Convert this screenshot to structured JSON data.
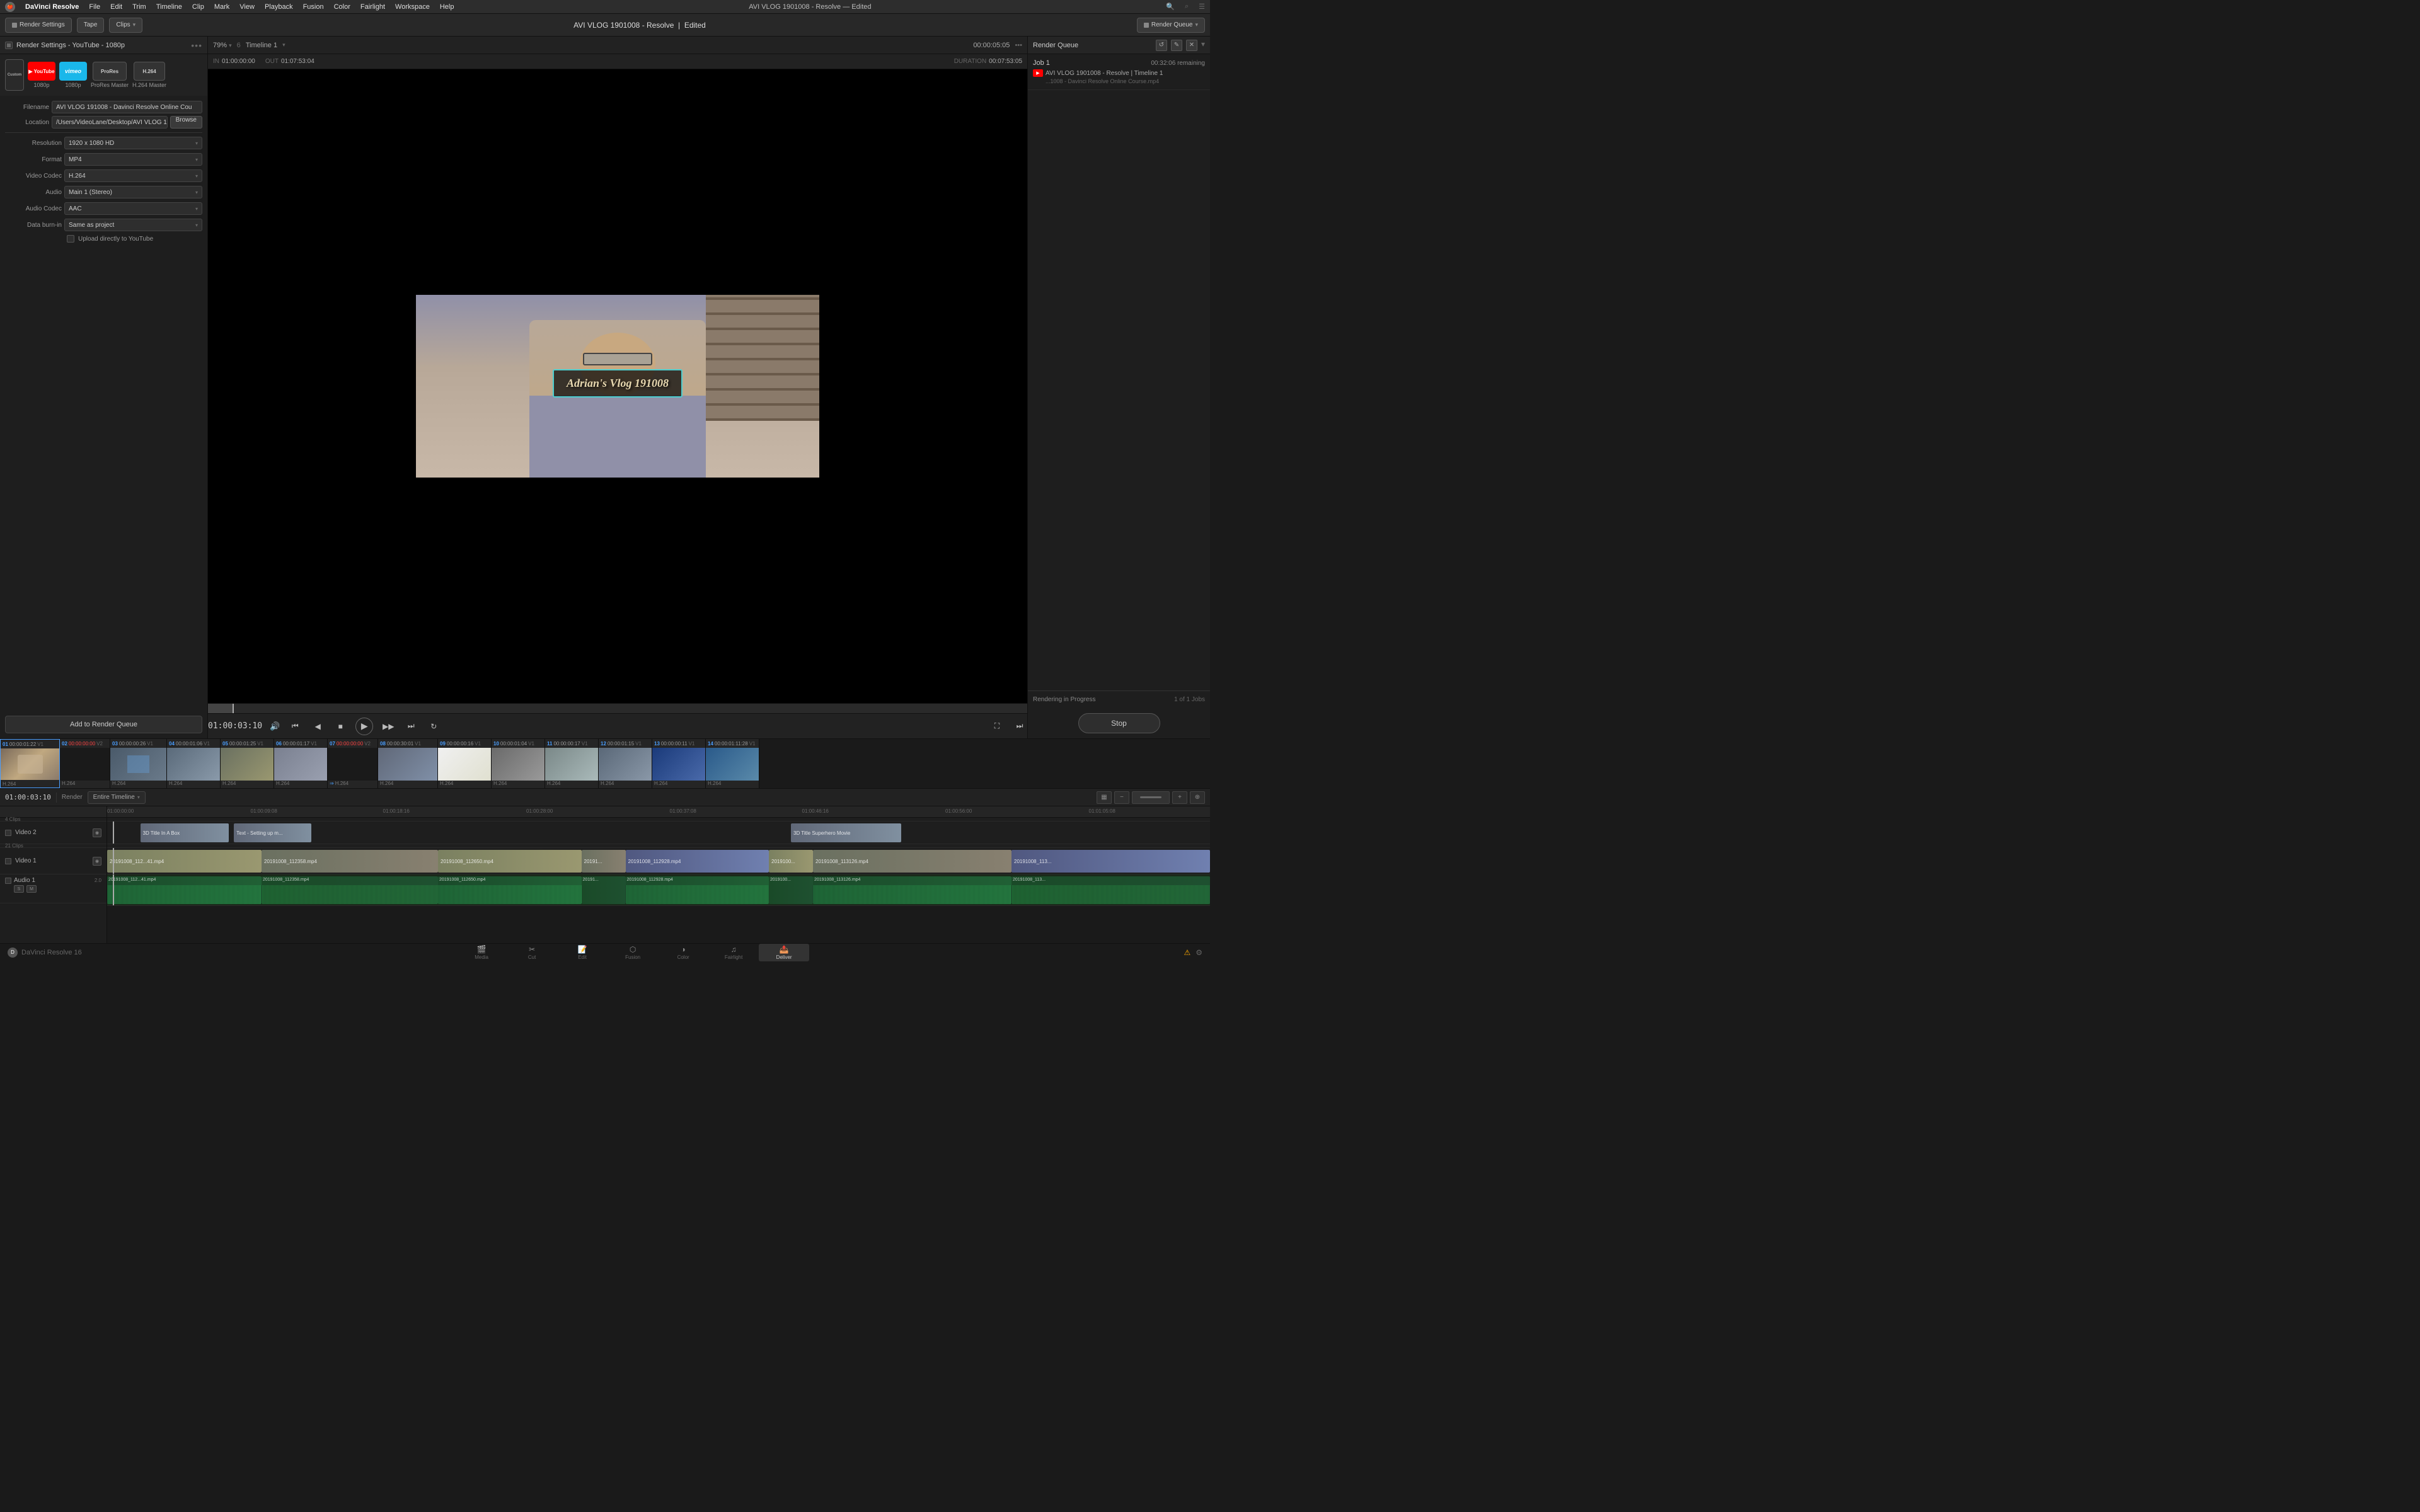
{
  "app": {
    "name": "DaVinci Resolve",
    "version": "DaVinci Resolve 16",
    "window_title": "AVI VLOG 1901008 - Resolve",
    "window_subtitle": "Edited"
  },
  "menu": {
    "apple": "🍎",
    "app_name": "DaVinci Resolve",
    "items": [
      "File",
      "Edit",
      "Trim",
      "Timeline",
      "Clip",
      "Mark",
      "View",
      "Playback",
      "Fusion",
      "Color",
      "Fairlight",
      "Workspace",
      "Help"
    ]
  },
  "toolbar": {
    "render_settings_label": "Render Settings",
    "tape_label": "Tape",
    "clips_label": "Clips",
    "title": "AVI VLOG 1901008 - Resolve",
    "subtitle": "Edited",
    "render_queue_label": "Render Queue"
  },
  "render_settings": {
    "panel_title": "Render Settings - YouTube - 1080p",
    "presets": [
      {
        "id": "custom",
        "label": "Custom"
      },
      {
        "id": "youtube",
        "label": "1080p",
        "brand": "YouTube"
      },
      {
        "id": "vimeo",
        "label": "1080p",
        "brand": "vimeo"
      },
      {
        "id": "prores",
        "label": "ProRes Master",
        "brand": "ProRes"
      },
      {
        "id": "h264",
        "label": "H.264 Master",
        "brand": "H.264"
      }
    ],
    "filename": "AVI VLOG 191008 - Davinci Resolve Online Cou",
    "location": "/Users/VideoLane/Desktop/AVI VLOG 191008 - ",
    "browse_label": "Browse",
    "resolution_label": "Resolution",
    "resolution_value": "1920 x 1080 HD",
    "format_label": "Format",
    "format_value": "MP4",
    "video_codec_label": "Video Codec",
    "video_codec_value": "H.264",
    "audio_label": "Audio",
    "audio_value": "Main 1 (Stereo)",
    "audio_codec_label": "Audio Codec",
    "audio_codec_value": "AAC",
    "data_burnin_label": "Data burn-in",
    "data_burnin_value": "Same as project",
    "upload_checkbox": "Upload directly to YouTube",
    "add_queue_btn": "Add to Render Queue"
  },
  "viewer": {
    "zoom": "79%",
    "frame_count": "6",
    "timeline_label": "Timeline 1",
    "timecode": "00:00:05:05",
    "in_point": "01:00:00:00",
    "out_point": "01:07:53:04",
    "duration_label": "DURATION",
    "duration": "00:07:53:05",
    "current_time": "01:00:03:10",
    "title_text": "Adrian's Vlog 191008"
  },
  "transport": {
    "skip_start": "⏮",
    "prev_frame": "◀",
    "stop": "■",
    "play": "▶",
    "next_frame": "▶",
    "skip_end": "⏭",
    "loop": "↻"
  },
  "render_queue": {
    "title": "Render Queue",
    "job_label": "Job 1",
    "job_time": "00:32:06 remaining",
    "job_filename": "AVI VLOG 1901008 - Resolve | Timeline 1",
    "job_subfile": "...1008 - Davinci Resolve Online Course.mp4",
    "status": "Rendering in Progress",
    "job_count": "1 of 1 Jobs",
    "stop_btn": "Stop"
  },
  "clip_browser": {
    "clips": [
      {
        "num": "01",
        "tc": "00:00:01:22",
        "track": "V1",
        "codec": "H.264",
        "active": true
      },
      {
        "num": "02",
        "tc": "00:00:00:00",
        "track": "V2",
        "codec": "H.264",
        "active": false,
        "red_tc": true
      },
      {
        "num": "03",
        "tc": "00:00:00:26",
        "track": "V1",
        "codec": "H.264",
        "active": false
      },
      {
        "num": "04",
        "tc": "00:00:01:06",
        "track": "V1",
        "codec": "H.264",
        "active": false
      },
      {
        "num": "05",
        "tc": "00:00:01:25",
        "track": "V1",
        "codec": "H.264",
        "active": false
      },
      {
        "num": "06",
        "tc": "00:00:01:17",
        "track": "V1",
        "codec": "H.264",
        "active": false
      },
      {
        "num": "07",
        "tc": "00:00:00:00",
        "track": "V2",
        "codec": "H.264",
        "active": false,
        "red_tc": true
      },
      {
        "num": "08",
        "tc": "00:00:30:01",
        "track": "V1",
        "codec": "H.264",
        "active": false
      },
      {
        "num": "09",
        "tc": "00:00:00:16",
        "track": "V1",
        "codec": "H.264",
        "active": false
      },
      {
        "num": "10",
        "tc": "00:00:01:04",
        "track": "V1",
        "codec": "H.264",
        "active": false
      },
      {
        "num": "11",
        "tc": "00:00:00:17",
        "track": "V1",
        "codec": "H.264",
        "active": false
      },
      {
        "num": "12",
        "tc": "00:00:01:15",
        "track": "V1",
        "codec": "H.264",
        "active": false
      },
      {
        "num": "13",
        "tc": "00:00:00:11",
        "track": "V1",
        "codec": "H.264",
        "active": false
      },
      {
        "num": "14",
        "tc": "00:00:01:11:28",
        "track": "V1",
        "codec": "H.264",
        "active": false
      }
    ]
  },
  "timeline": {
    "current_tc": "01:00:03:10",
    "render_label": "Render",
    "range_label": "Entire Timeline",
    "ruler_marks": [
      "01:00:00:00",
      "01:00:09:08",
      "01:00:18:16",
      "01:00:28:00",
      "01:00:37:08",
      "01:00:46:16",
      "01:00:56:00",
      "01:01:05:08"
    ],
    "tracks": [
      {
        "name": "V2",
        "full_name": "Video 2",
        "clips": [
          {
            "label": "3D Title In A Box",
            "color": "title",
            "left_pct": 3,
            "width_pct": 12
          },
          {
            "label": "Text - Setting up m...",
            "color": "title",
            "left_pct": 13,
            "width_pct": 8
          },
          {
            "label": "3D Title Superhero Movie",
            "color": "title",
            "left_pct": 62,
            "width_pct": 13
          }
        ]
      },
      {
        "name": "V1",
        "full_name": "Video 1",
        "clips": [
          {
            "label": "20191008_112...41.mp4",
            "color": "video",
            "left_pct": 1,
            "width_pct": 26
          },
          {
            "label": "20191008_112358.mp4",
            "color": "video2",
            "left_pct": 16,
            "width_pct": 20
          },
          {
            "label": "20191008_112650.mp4",
            "color": "video",
            "left_pct": 32,
            "width_pct": 14
          },
          {
            "label": "20191...",
            "color": "video2",
            "left_pct": 43,
            "width_pct": 6
          },
          {
            "label": "20191008_112928.mp4",
            "color": "blue",
            "left_pct": 46,
            "width_pct": 16
          },
          {
            "label": "2019100...",
            "color": "video",
            "left_pct": 60,
            "width_pct": 5
          },
          {
            "label": "20191008_113126.mp4",
            "color": "video2",
            "left_pct": 68,
            "width_pct": 20
          },
          {
            "label": "20191008_113...",
            "color": "blue",
            "left_pct": 86,
            "width_pct": 14
          }
        ]
      },
      {
        "name": "A1",
        "full_name": "Audio 1",
        "clips": [
          {
            "label": "20191008_112...41.mp4",
            "left_pct": 1,
            "width_pct": 26
          },
          {
            "label": "20191008_112358.mp4",
            "left_pct": 16,
            "width_pct": 20
          },
          {
            "label": "20191008_112650.mp4",
            "left_pct": 32,
            "width_pct": 14
          },
          {
            "label": "20191...",
            "left_pct": 43,
            "width_pct": 6
          },
          {
            "label": "20191008_112928.mp4",
            "left_pct": 46,
            "width_pct": 16
          },
          {
            "label": "2019100...",
            "left_pct": 60,
            "width_pct": 5
          },
          {
            "label": "20191008_113126.mp4",
            "left_pct": 68,
            "width_pct": 20
          },
          {
            "label": "20191008_113...",
            "left_pct": 86,
            "width_pct": 14
          }
        ]
      }
    ]
  },
  "bottom_nav": {
    "items": [
      {
        "id": "media",
        "label": "Media",
        "icon": "🎬"
      },
      {
        "id": "cut",
        "label": "Cut",
        "icon": "✂"
      },
      {
        "id": "edit",
        "label": "Edit",
        "icon": "📝"
      },
      {
        "id": "fusion",
        "label": "Fusion",
        "icon": "⬡"
      },
      {
        "id": "color",
        "label": "Color",
        "icon": "◑"
      },
      {
        "id": "fairlight",
        "label": "Fairlight",
        "icon": "♫"
      },
      {
        "id": "deliver",
        "label": "Deliver",
        "icon": "📤",
        "active": true
      }
    ]
  },
  "icons": {
    "menu_icon": "≡",
    "dots_icon": "•••",
    "chevron_down": "▾",
    "checkmark": "✓",
    "pencil_icon": "✎",
    "lock_icon": "🔒",
    "speaker_icon": "🔊",
    "loop_icon": "↻",
    "fullscreen_icon": "⛶"
  }
}
